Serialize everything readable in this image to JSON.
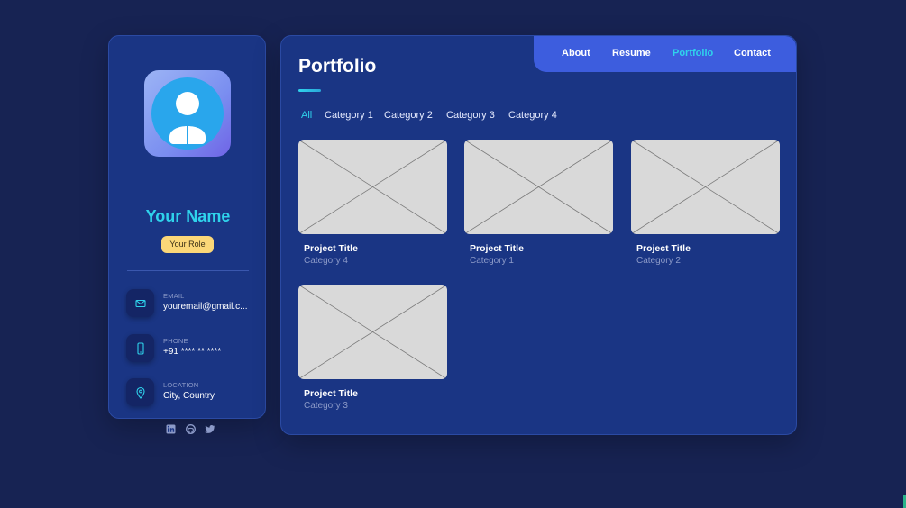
{
  "profile": {
    "name": "Your Name",
    "role": "Your Role",
    "avatar_icon": "user-icon"
  },
  "contacts": [
    {
      "label": "EMAIL",
      "value": "youremail@gmail.c...",
      "icon": "mail-icon"
    },
    {
      "label": "PHONE",
      "value": "+91 **** ** ****",
      "icon": "phone-icon"
    },
    {
      "label": "LOCATION",
      "value": "City, Country",
      "icon": "location-pin-icon"
    }
  ],
  "socials": [
    "linkedin-icon",
    "github-icon",
    "twitter-icon"
  ],
  "nav": {
    "items": [
      "About",
      "Resume",
      "Portfolio",
      "Contact"
    ],
    "active": "Portfolio"
  },
  "page": {
    "title": "Portfolio"
  },
  "filters": {
    "items": [
      "All",
      "Category 1",
      "Category 2",
      "Category 3",
      "Category 4"
    ],
    "active": "All"
  },
  "projects": [
    {
      "title": "Project Title",
      "category": "Category 4"
    },
    {
      "title": "Project Title",
      "category": "Category 1"
    },
    {
      "title": "Project Title",
      "category": "Category 2"
    },
    {
      "title": "Project Title",
      "category": "Category 3"
    }
  ],
  "colors": {
    "background": "#172353",
    "panel": "#1a3584",
    "accent": "#2fd3ec",
    "navbar": "#3d5dde",
    "role_badge": "#fbd778"
  }
}
